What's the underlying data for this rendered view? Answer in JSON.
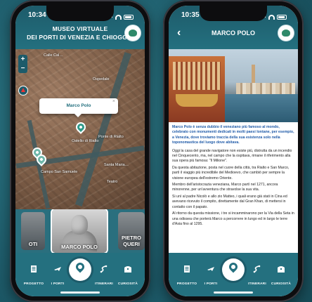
{
  "left_phone": {
    "status": {
      "time": "10:34"
    },
    "header": {
      "line1": "MUSEO VIRTUALE",
      "line2": "DEI PORTI DI VENEZIA E CHIOGGIA"
    },
    "map": {
      "zoom_in": "+",
      "zoom_out": "−",
      "popup": {
        "title": "Marco Polo",
        "close": "×"
      },
      "labels": [
        "Calle Cal…",
        "Campo San Samuele",
        "Ospedale",
        "Ponte di Rialto",
        "Teatro",
        "Santa Maria…",
        "Ostello di Rialto"
      ]
    },
    "carousel": {
      "left_label": "OTI",
      "center_label": "MARCO POLO",
      "right_label": "PIETRO QUERI"
    }
  },
  "right_phone": {
    "status": {
      "time": "10:35"
    },
    "header": {
      "title": "MARCO POLO",
      "back": "‹"
    },
    "article": {
      "lead": "Marco Polo è senza dubbio il veneziano più famoso al mondo, celebrato con monumenti dedicati in molti paesi lontane, per esempio, a Venezia, dove troviamo traccia della sua esistenza solo nella toponomastica del luogo dove abitava.",
      "paragraphs": [
        "Oggi la casa del grande navigatore non esiste più, distrutta da un incendio nel Cinquecento, ma, nel campo che la ospitava, rimane il riferimento alla sua opera più famosa: \"Il Milione\".",
        "Da questa abitazione, posta nel cuore della città, tra Rialto e San Marco, partì il viaggio più incredibile del Medioevo, che cambiò per sempre la visione europea dell'estremo Oriente.",
        "Membro dell'aristocrazia veneziana, Marco partì nel 1271, ancora minorenne, per un'avventura che stravolse la sua vita.",
        "Si unì al padre Nicolò e allo zio Matteo, i quali erano già stati in Cina ed avevano ricevuto il compito, direttamente dal Gran Khan, di mettersi in contatto con il papato.",
        "Al ritorno da questa missione, i tre si incamminarono per la Via della Seta in una odissea che porterà Marco a percorrere in lungo ed in largo le terre d'Asia fino al 1295."
      ]
    }
  },
  "tabbar": {
    "tabs": [
      {
        "label": "PROGETTO",
        "icon": "document-icon"
      },
      {
        "label": "I PORTI",
        "icon": "plane-icon"
      },
      {
        "label": "ITINERARI",
        "icon": "route-icon"
      },
      {
        "label": "CURIOSITÀ",
        "icon": "treasure-chest-icon"
      }
    ]
  },
  "colors": {
    "primary": "#24707f",
    "dark": "#1d5b6a",
    "accent": "#2f9a8a",
    "link": "#1f5aa8"
  }
}
